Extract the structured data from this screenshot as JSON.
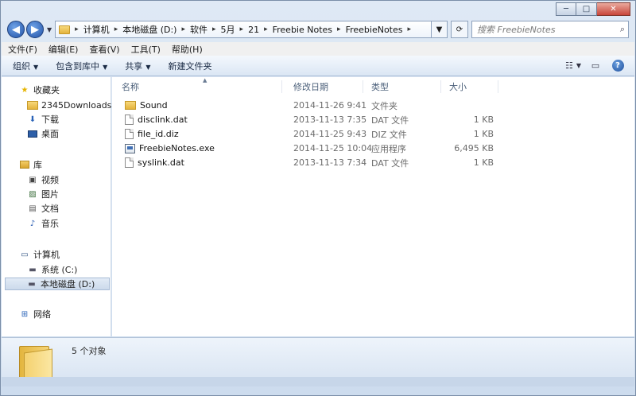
{
  "window": {
    "controls": {
      "minimize": "─",
      "maximize": "□",
      "close": "✕"
    }
  },
  "address": {
    "back": "◀",
    "forward": "▶",
    "history_dropdown": "▼",
    "crumbs": [
      "计算机",
      "本地磁盘 (D:)",
      "软件",
      "5月",
      "21",
      "Freebie Notes",
      "FreebieNotes"
    ],
    "dropdown": "▼",
    "refresh": "⟳",
    "search_placeholder": "搜索 FreebieNotes",
    "search_icon": "⌕"
  },
  "menubar": [
    "文件(F)",
    "编辑(E)",
    "查看(V)",
    "工具(T)",
    "帮助(H)"
  ],
  "toolbar": {
    "organize": "组织",
    "include_library": "包含到库中",
    "share": "共享",
    "new_folder": "新建文件夹",
    "dropdown": "▼",
    "view_icon": "☷",
    "preview_icon": "▭",
    "help": "?"
  },
  "nav": {
    "favorites": "收藏夹",
    "downloads_2345": "2345Downloads",
    "downloads": "下载",
    "desktop": "桌面",
    "libraries": "库",
    "videos": "视频",
    "pictures": "图片",
    "documents": "文档",
    "music": "音乐",
    "computer": "计算机",
    "drive_c": "系统 (C:)",
    "drive_d": "本地磁盘 (D:)",
    "network": "网络"
  },
  "columns": {
    "name": "名称",
    "date": "修改日期",
    "type": "类型",
    "size": "大小",
    "sort_indicator": "▲"
  },
  "files": [
    {
      "name": "Sound",
      "date": "2014-11-26 9:41",
      "type": "文件夹",
      "size": "",
      "icon": "folder"
    },
    {
      "name": "disclink.dat",
      "date": "2013-11-13 7:35",
      "type": "DAT 文件",
      "size": "1 KB",
      "icon": "doc"
    },
    {
      "name": "file_id.diz",
      "date": "2014-11-25 9:43",
      "type": "DIZ 文件",
      "size": "1 KB",
      "icon": "doc"
    },
    {
      "name": "FreebieNotes.exe",
      "date": "2014-11-25 10:04",
      "type": "应用程序",
      "size": "6,495 KB",
      "icon": "exe"
    },
    {
      "name": "syslink.dat",
      "date": "2013-11-13 7:34",
      "type": "DAT 文件",
      "size": "1 KB",
      "icon": "doc"
    }
  ],
  "details": {
    "object_count": "5 个对象"
  }
}
